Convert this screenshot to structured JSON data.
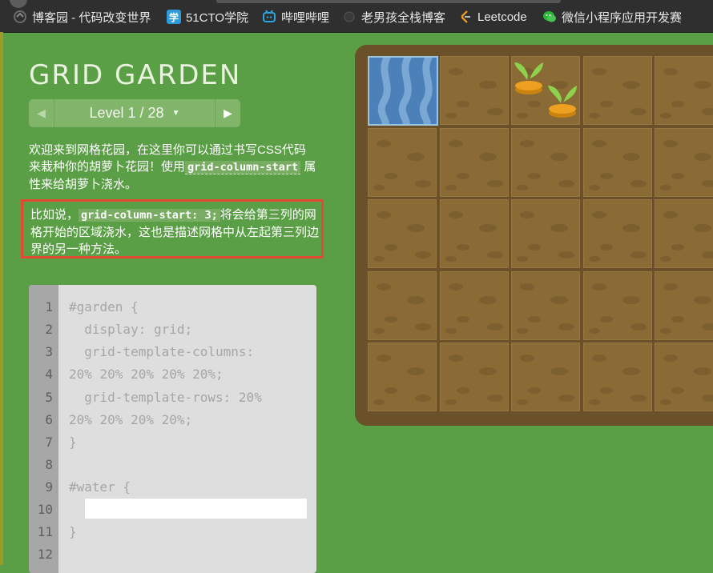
{
  "bookmarks": [
    {
      "label": "博客园 - 代码改变世界",
      "icon": "cnblogs-icon",
      "glyph": ""
    },
    {
      "label": "51CTO学院",
      "icon": "51cto-icon",
      "glyph": "学"
    },
    {
      "label": "哔哩哔哩",
      "icon": "bilibili-icon",
      "glyph": "▭"
    },
    {
      "label": "老男孩全栈博客",
      "icon": "blog-icon",
      "glyph": ""
    },
    {
      "label": "Leetcode",
      "icon": "leetcode-icon",
      "glyph": ""
    },
    {
      "label": "微信小程序应用开发赛",
      "icon": "wechat-icon",
      "glyph": ""
    }
  ],
  "app": {
    "title": "GRID GARDEN",
    "level_label": "Level 1 / 28",
    "prev_glyph": "◀",
    "next_glyph": "▶",
    "caret_glyph": "▼"
  },
  "instructions": {
    "p1_a": "欢迎来到网格花园，在这里你可以通过书写CSS代码来栽种你的胡萝卜花园！使用",
    "p1_code": "grid-column-start",
    "p1_b": "属性来给胡萝卜浇水。",
    "p2_a": "比如说，",
    "p2_code": "grid-column-start: 3;",
    "p2_b": "将会给第三列的网格开始的区域浇水，这也是描述网格中从左起第三列边界的另一种方法。"
  },
  "editor": {
    "line_numbers": [
      "1",
      "2",
      "3",
      "4",
      "5",
      "6",
      "7",
      "8",
      "9",
      "10",
      "11",
      "12"
    ],
    "lines": [
      "#garden {",
      "  display: grid;",
      "  grid-template-columns:",
      "20% 20% 20% 20% 20%;",
      "  grid-template-rows: 20%",
      "20% 20% 20% 20%;",
      "}",
      "",
      "#water {",
      "",
      "}",
      ""
    ],
    "input_value": ""
  },
  "colors": {
    "background": "#5a9e45",
    "highlight_border": "#e34a33",
    "soil": "#8a6a35",
    "water": "#4b80b8",
    "carrot": "#f0a020",
    "leaf": "#8ed14e"
  }
}
